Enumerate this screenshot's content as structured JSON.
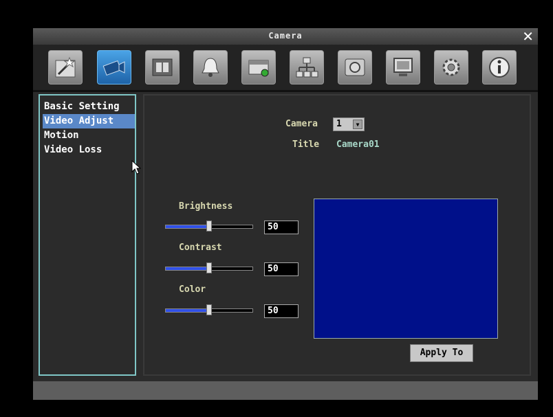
{
  "window": {
    "title": "Camera"
  },
  "toolbar": {
    "buttons": [
      {
        "icon": "wizard-icon",
        "active": false
      },
      {
        "icon": "camera-icon",
        "active": true
      },
      {
        "icon": "film-icon",
        "active": false
      },
      {
        "icon": "bell-icon",
        "active": false
      },
      {
        "icon": "storage-icon",
        "active": false
      },
      {
        "icon": "network-icon",
        "active": false
      },
      {
        "icon": "disk-icon",
        "active": false
      },
      {
        "icon": "monitor-icon",
        "active": false
      },
      {
        "icon": "gear-icon",
        "active": false
      },
      {
        "icon": "info-icon",
        "active": false
      }
    ]
  },
  "sidebar": {
    "items": [
      {
        "label": "Basic Setting"
      },
      {
        "label": "Video Adjust",
        "selected": true
      },
      {
        "label": "Motion"
      },
      {
        "label": "Video Loss"
      }
    ]
  },
  "content": {
    "camera_label": "Camera",
    "camera_value": "1",
    "title_label": "Title",
    "title_value": "Camera01",
    "brightness": {
      "label": "Brightness",
      "value": "50",
      "level": 0.5
    },
    "contrast": {
      "label": "Contrast",
      "value": "50",
      "level": 0.5
    },
    "color": {
      "label": "Color",
      "value": "50",
      "level": 0.5
    },
    "apply_label": "Apply To"
  },
  "colors": {
    "accent": "#5a88c8",
    "preview": "#00108a",
    "slider": "#3050e8"
  }
}
